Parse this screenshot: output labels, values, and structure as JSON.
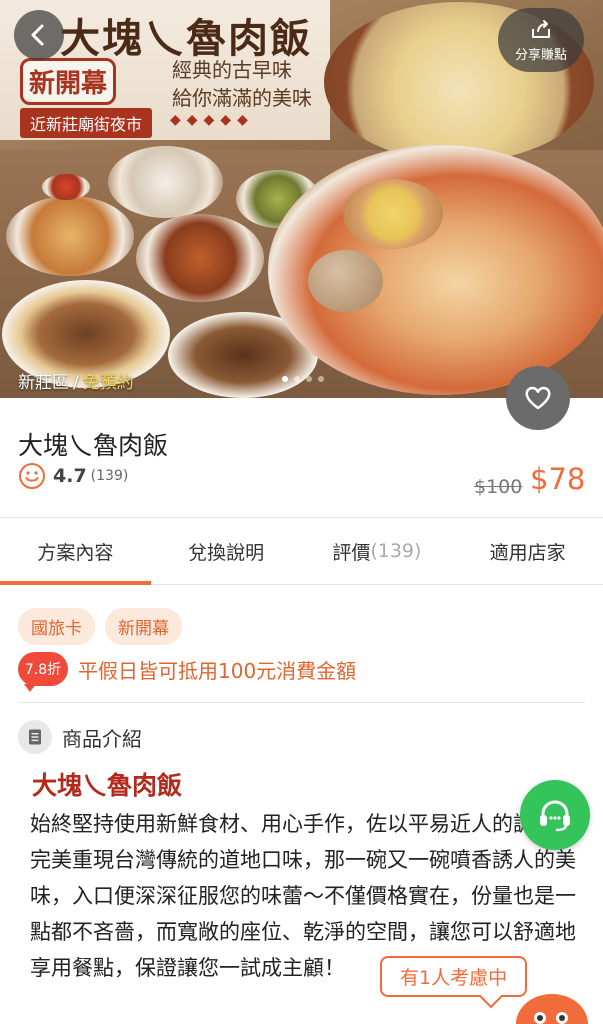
{
  "hero": {
    "brand": "大塊乀魯肉飯",
    "stamp": "新開幕",
    "slogan_line1": "經典的古早味",
    "slogan_line2": "給你滿滿的美味",
    "near": "近新莊廟街夜市",
    "dots": "◆◆◆◆◆",
    "share_label": "分享賺點",
    "location": "新莊區",
    "separator": "/",
    "booking": "免預約",
    "page_count": 4,
    "page_active": 1
  },
  "product": {
    "title": "大塊乀魯肉飯",
    "rating": "4.7",
    "rating_count": "(139)",
    "price_original": "$100",
    "price_sale": "$78"
  },
  "tabs": [
    {
      "label": "方案內容",
      "extra": "",
      "active": true
    },
    {
      "label": "兌換說明",
      "extra": "",
      "active": false
    },
    {
      "label": "評價",
      "extra": "(139)",
      "active": false
    },
    {
      "label": "適用店家",
      "extra": "",
      "active": false
    }
  ],
  "tags": [
    "國旅卡",
    "新開幕"
  ],
  "promo": {
    "discount": "7.8折",
    "text": "平假日皆可抵用100元消費金額"
  },
  "intro": {
    "heading": "商品介紹",
    "title": "大塊乀魯肉飯",
    "body": "始終堅持使用新鮮食材、用心手作，佐以平易近人的調味，完美重現台灣傳統的道地口味，那一碗又一碗噴香誘人的美味，入口便深深征服您的味蕾～不僅價格實在，份量也是一點都不吝嗇，而寬敞的座位、乾淨的空間，讓您可以舒適地享用餐點，保證讓您一試成主顧！"
  },
  "floaters": {
    "viewing": "有1人考慮中"
  },
  "colors": {
    "accent": "#f26b3a",
    "brand_red": "#b3291c",
    "support_green": "#35c45a"
  }
}
